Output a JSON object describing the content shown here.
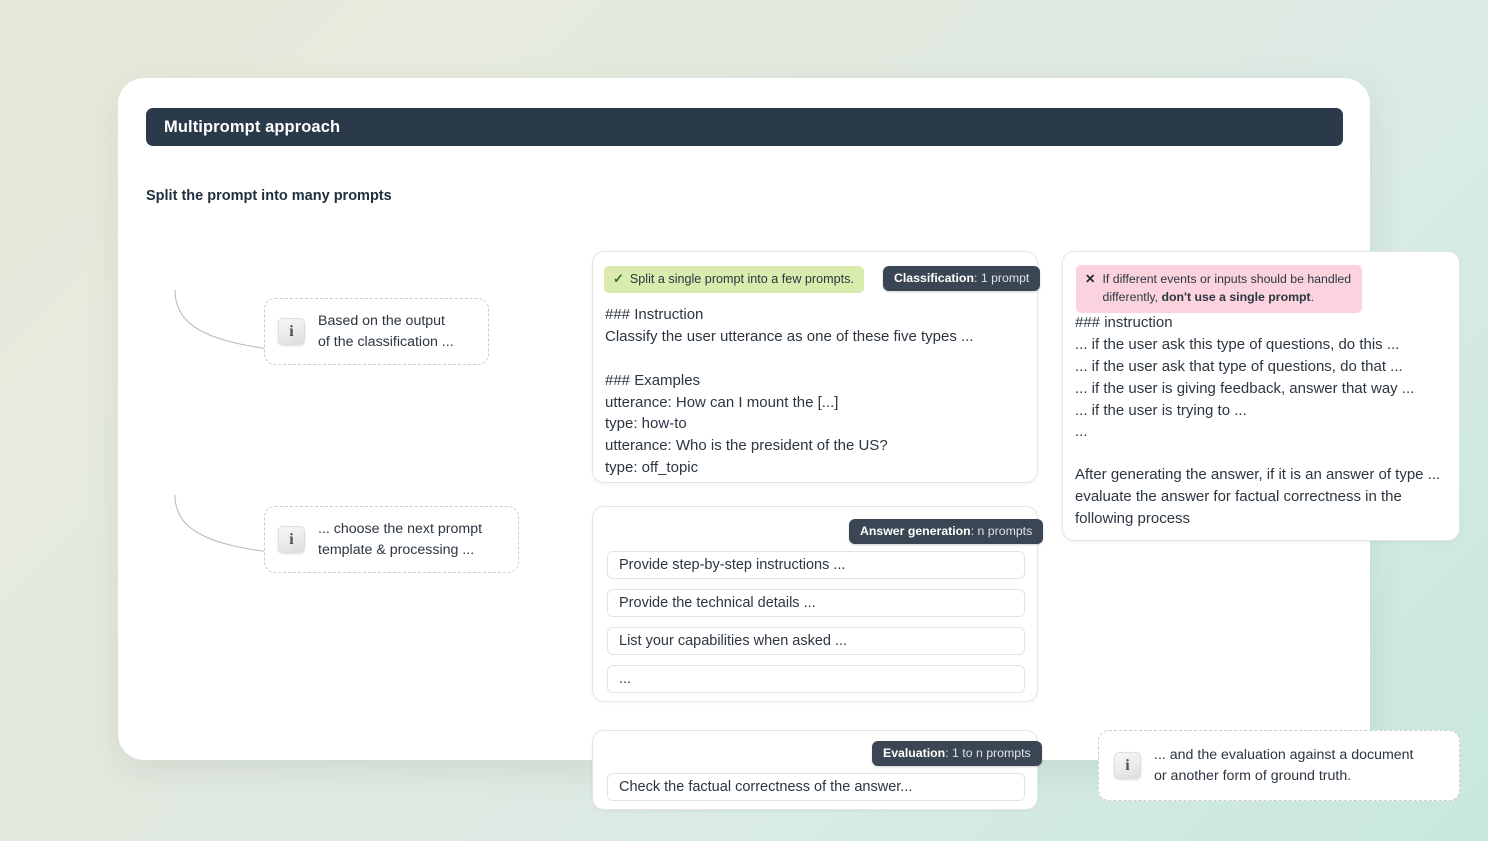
{
  "header": {
    "title": "Multiprompt approach"
  },
  "left": {
    "section_title": "Split the prompt into many prompts",
    "callouts": [
      {
        "icon": "info-icon",
        "icon_glyph": "i",
        "text": "Based on the output\nof the classification ..."
      },
      {
        "icon": "info-icon",
        "icon_glyph": "i",
        "text": "... choose the next prompt\ntemplate & processing ..."
      },
      {
        "icon": "info-icon",
        "icon_glyph": "i",
        "text": "... and the evaluation against a document\nor another form of ground truth."
      }
    ]
  },
  "cards": {
    "classification": {
      "good_badge": {
        "icon": "check-icon",
        "icon_glyph": "✓",
        "text": "Split a single prompt into a few prompts."
      },
      "badge": {
        "label": "Classification",
        "value": "1 prompt"
      },
      "body": "### Instruction\nClassify the user utterance as one of these five types ...\n\n### Examples\nutterance: How can I mount the [...]\ntype: how-to\nutterance: Who is the president of the US?\ntype: off_topic"
    },
    "answer_generation": {
      "badge": {
        "label": "Answer generation",
        "value": "n prompts"
      },
      "rows": [
        "Provide step-by-step instructions ...",
        "Provide the technical details ...",
        "List your capabilities when asked ...",
        "..."
      ]
    },
    "evaluation": {
      "badge": {
        "label": "Evaluation",
        "value": "1 to n prompts"
      },
      "rows": [
        "Check the factual correctness of the answer..."
      ]
    },
    "single_prompt": {
      "bad_badge": {
        "icon": "x-icon",
        "icon_glyph": "✕",
        "text_before": "If different events or inputs should be handled differently, ",
        "text_bold": "don't use a single prompt",
        "text_after": "."
      },
      "body": "### instruction\n... if the user ask this type of questions, do this ...\n... if the user ask that type of questions, do that ...\n... if the user is giving feedback, answer that way ...\n... if the user is trying to ...\n...",
      "body_2": "After generating the answer, if it is an answer of type ... evaluate the answer for factual correctness in the following process"
    }
  },
  "colors": {
    "header_bar": "#2b3a4a",
    "badge_dark": "#3a4653",
    "badge_good": "#d9ecad",
    "badge_bad": "#fbd3de",
    "panel": "#ffffff"
  }
}
